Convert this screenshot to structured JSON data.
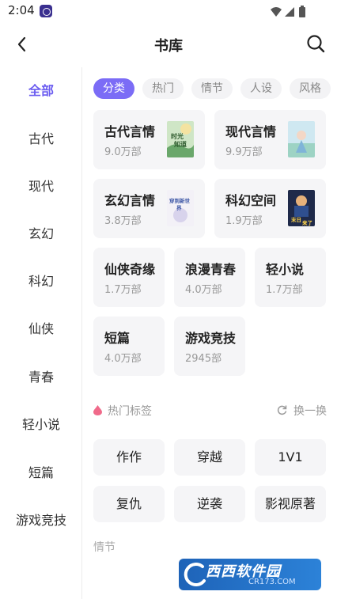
{
  "status_bar": {
    "time": "2:04"
  },
  "header": {
    "title": "书库"
  },
  "sidebar": {
    "items": [
      {
        "label": "全部",
        "active": true
      },
      {
        "label": "古代",
        "active": false
      },
      {
        "label": "现代",
        "active": false
      },
      {
        "label": "玄幻",
        "active": false
      },
      {
        "label": "科幻",
        "active": false
      },
      {
        "label": "仙侠",
        "active": false
      },
      {
        "label": "青春",
        "active": false
      },
      {
        "label": "轻小说",
        "active": false
      },
      {
        "label": "短篇",
        "active": false
      },
      {
        "label": "游戏竞技",
        "active": false
      }
    ]
  },
  "filters": {
    "chips": [
      {
        "label": "分类",
        "active": true
      },
      {
        "label": "热门",
        "active": false
      },
      {
        "label": "情节",
        "active": false
      },
      {
        "label": "人设",
        "active": false
      },
      {
        "label": "风格",
        "active": false
      }
    ]
  },
  "categories": {
    "featured": [
      {
        "name": "古代言情",
        "count": "9.0万部",
        "cover_text": "时光\n知道"
      },
      {
        "name": "现代言情",
        "count": "9.9万部",
        "cover_text": ""
      },
      {
        "name": "玄幻言情",
        "count": "3.8万部",
        "cover_text": "穿到新世\n界"
      },
      {
        "name": "科幻空间",
        "count": "1.9万部",
        "cover_text": "末日\n来了"
      }
    ],
    "small": [
      {
        "name": "仙侠奇缘",
        "count": "1.7万部"
      },
      {
        "name": "浪漫青春",
        "count": "4.0万部"
      },
      {
        "name": "轻小说",
        "count": "1.7万部"
      },
      {
        "name": "短篇",
        "count": "4.0万部"
      },
      {
        "name": "游戏竞技",
        "count": "2945部"
      }
    ]
  },
  "hot_tags": {
    "title": "热门标签",
    "refresh_label": "换一换",
    "tags": [
      "作作",
      "穿越",
      "1V1",
      "复仇",
      "逆袭",
      "影视原著"
    ]
  },
  "plot_section": {
    "label": "情节"
  },
  "watermark": {
    "text": "西西软件园",
    "url": "CR173.COM"
  },
  "colors": {
    "accent": "#7b6cf6",
    "card_bg": "#f5f5f7",
    "sidebar_active": "#6b5cf0"
  }
}
